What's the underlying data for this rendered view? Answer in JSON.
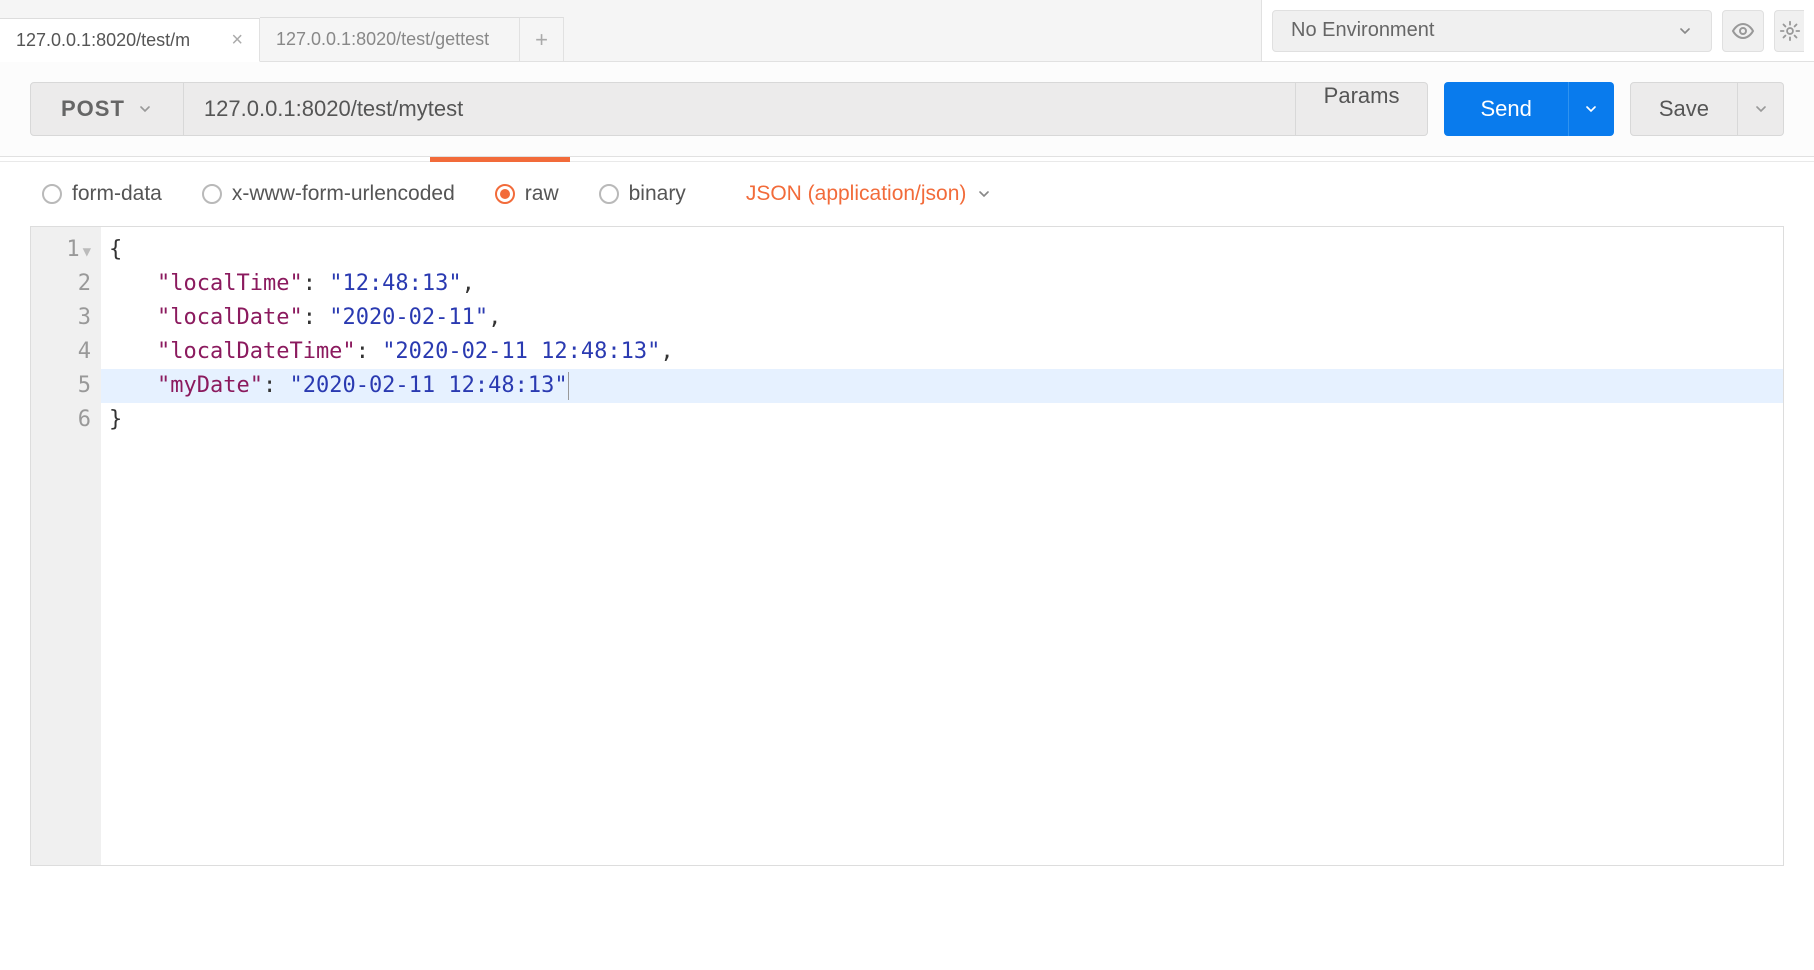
{
  "tabs": [
    {
      "label": "127.0.0.1:8020/test/m",
      "active": true
    },
    {
      "label": "127.0.0.1:8020/test/gettest",
      "active": false
    }
  ],
  "environment": {
    "selected": "No Environment"
  },
  "request": {
    "method": "POST",
    "url": "127.0.0.1:8020/test/mytest",
    "params_label": "Params",
    "send_label": "Send",
    "save_label": "Save"
  },
  "body_types": {
    "form_data": "form-data",
    "urlencoded": "x-www-form-urlencoded",
    "raw": "raw",
    "binary": "binary",
    "selected": "raw",
    "content_type": "JSON (application/json)"
  },
  "editor": {
    "line_numbers": [
      "1",
      "2",
      "3",
      "4",
      "5",
      "6"
    ],
    "highlighted_line": 5,
    "json": {
      "localTime": "12:48:13",
      "localDate": "2020-02-11",
      "localDateTime": "2020-02-11 12:48:13",
      "myDate": "2020-02-11 12:48:13"
    },
    "tokens": [
      [
        {
          "t": "brace",
          "v": "{"
        }
      ],
      [
        {
          "t": "indent"
        },
        {
          "t": "key",
          "v": "\"localTime\""
        },
        {
          "t": "colon",
          "v": ": "
        },
        {
          "t": "str",
          "v": "\"12:48:13\""
        },
        {
          "t": "comma",
          "v": ","
        }
      ],
      [
        {
          "t": "indent"
        },
        {
          "t": "key",
          "v": "\"localDate\""
        },
        {
          "t": "colon",
          "v": ": "
        },
        {
          "t": "str",
          "v": "\"2020-02-11\""
        },
        {
          "t": "comma",
          "v": ","
        }
      ],
      [
        {
          "t": "indent"
        },
        {
          "t": "key",
          "v": "\"localDateTime\""
        },
        {
          "t": "colon",
          "v": ": "
        },
        {
          "t": "str",
          "v": "\"2020-02-11 12:48:13\""
        },
        {
          "t": "comma",
          "v": ","
        }
      ],
      [
        {
          "t": "indent"
        },
        {
          "t": "key",
          "v": "\"myDate\""
        },
        {
          "t": "colon",
          "v": ": "
        },
        {
          "t": "str",
          "v": "\"2020-02-11 12:48:13\""
        }
      ],
      [
        {
          "t": "brace",
          "v": "}"
        }
      ]
    ]
  }
}
